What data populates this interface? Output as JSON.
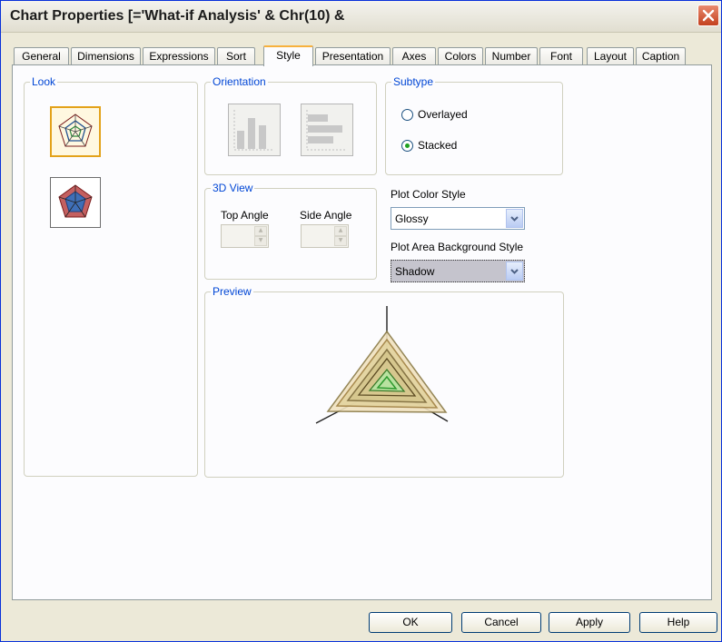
{
  "window": {
    "title": "Chart Properties [='What-if Analysis' & Chr(10) &"
  },
  "tabs": [
    {
      "label": "General"
    },
    {
      "label": "Dimensions"
    },
    {
      "label": "Expressions"
    },
    {
      "label": "Sort"
    },
    {
      "label": "Style"
    },
    {
      "label": "Presentation"
    },
    {
      "label": "Axes"
    },
    {
      "label": "Colors"
    },
    {
      "label": "Number"
    },
    {
      "label": "Font"
    },
    {
      "label": "Layout"
    },
    {
      "label": "Caption"
    }
  ],
  "active_tab": "Style",
  "look": {
    "legend": "Look",
    "options": [
      "radar-line-icon",
      "radar-filled-icon"
    ],
    "selected": 0
  },
  "orientation": {
    "legend": "Orientation",
    "options": [
      "vertical-bars-icon",
      "horizontal-bars-icon"
    ]
  },
  "subtype": {
    "legend": "Subtype",
    "overlayed": "Overlayed",
    "stacked": "Stacked",
    "selected": "Stacked"
  },
  "view3d": {
    "legend": "3D View",
    "top_angle": "Top Angle",
    "side_angle": "Side Angle"
  },
  "plot_color": {
    "label": "Plot Color Style",
    "value": "Glossy"
  },
  "plot_area": {
    "label": "Plot Area Background Style",
    "value": "Shadow"
  },
  "preview": {
    "legend": "Preview"
  },
  "buttons": {
    "ok": "OK",
    "cancel": "Cancel",
    "apply": "Apply",
    "help": "Help"
  },
  "colors": {
    "accent": "#0046D5",
    "tab_highlight": "#F7B13E",
    "dialog_bg": "#ECE9D8"
  }
}
